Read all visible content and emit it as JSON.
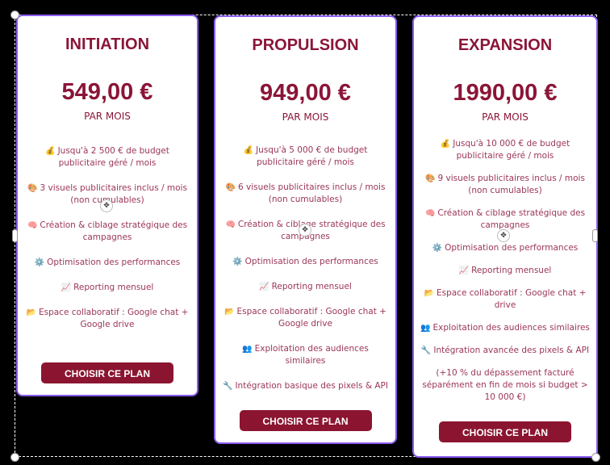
{
  "plans": [
    {
      "name": "INITIATION",
      "price": "549,00 €",
      "period": "PAR MOIS",
      "cta": "CHOISIR CE PLAN",
      "features": [
        {
          "icon": "money-bag-icon",
          "glyph": "💰",
          "text": "Jusqu'à 2 500 € de budget publicitaire géré / mois"
        },
        {
          "icon": "palette-icon",
          "glyph": "🎨",
          "text": "3 visuels publicitaires inclus / mois (non cumulables)"
        },
        {
          "icon": "brain-icon",
          "glyph": "🧠",
          "text": "Création & ciblage stratégique des campagnes"
        },
        {
          "icon": "gear-icon",
          "glyph": "⚙️",
          "text": "Optimisation des performances"
        },
        {
          "icon": "chart-icon",
          "glyph": "📈",
          "text": "Reporting mensuel"
        },
        {
          "icon": "folder-icon",
          "glyph": "📂",
          "text": "Espace collaboratif : Google chat + Google drive"
        }
      ]
    },
    {
      "name": "PROPULSION",
      "price": "949,00 €",
      "period": "PAR MOIS",
      "cta": "CHOISIR CE PLAN",
      "features": [
        {
          "icon": "money-bag-icon",
          "glyph": "💰",
          "text": "Jusqu'à 5 000 € de budget publicitaire géré / mois"
        },
        {
          "icon": "palette-icon",
          "glyph": "🎨",
          "text": "6 visuels publicitaires inclus / mois (non cumulables)"
        },
        {
          "icon": "brain-icon",
          "glyph": "🧠",
          "text": "Création & ciblage stratégique des campagnes"
        },
        {
          "icon": "gear-icon",
          "glyph": "⚙️",
          "text": "Optimisation des performances"
        },
        {
          "icon": "chart-icon",
          "glyph": "📈",
          "text": "Reporting mensuel"
        },
        {
          "icon": "folder-icon",
          "glyph": "📂",
          "text": "Espace collaboratif : Google chat + Google drive"
        },
        {
          "icon": "people-icon",
          "glyph": "👥",
          "text": "Exploitation des audiences similaires"
        },
        {
          "icon": "wrench-icon",
          "glyph": "🔧",
          "text": "Intégration basique des pixels & API"
        }
      ]
    },
    {
      "name": "EXPANSION",
      "price": "1990,00 €",
      "period": "PAR MOIS",
      "cta": "CHOISIR CE PLAN",
      "features": [
        {
          "icon": "money-bag-icon",
          "glyph": "💰",
          "text": "Jusqu'à 10 000 € de budget publicitaire géré / mois"
        },
        {
          "icon": "palette-icon",
          "glyph": "🎨",
          "text": "9 visuels publicitaires inclus / mois (non cumulables)"
        },
        {
          "icon": "brain-icon",
          "glyph": "🧠",
          "text": "Création & ciblage stratégique des campagnes"
        },
        {
          "icon": "gear-icon",
          "glyph": "⚙️",
          "text": "Optimisation des performances"
        },
        {
          "icon": "chart-icon",
          "glyph": "📈",
          "text": "Reporting mensuel"
        },
        {
          "icon": "folder-icon",
          "glyph": "📂",
          "text": "Espace collaboratif : Google chat + drive"
        },
        {
          "icon": "people-icon",
          "glyph": "👥",
          "text": "Exploitation des audiences similaires"
        },
        {
          "icon": "wrench-icon",
          "glyph": "🔧",
          "text": "Intégration avancée des pixels & API"
        },
        {
          "icon": "",
          "glyph": "",
          "text": "(+10 % du dépassement facturé séparément en fin de mois si budget > 10 000 €)"
        }
      ]
    }
  ],
  "colors": {
    "accent": "#8b1538",
    "button": "#8b1530",
    "selection": "#8a5cf0"
  }
}
